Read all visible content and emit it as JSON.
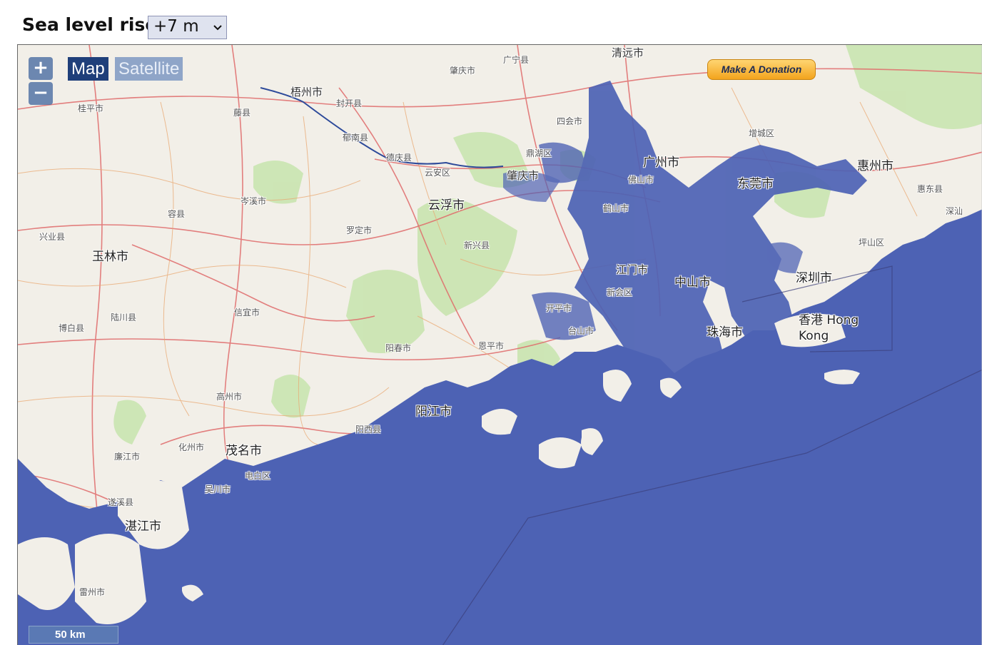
{
  "header": {
    "label": "Sea level rise:",
    "selected_value": "+7 m"
  },
  "controls": {
    "zoom_in": "+",
    "zoom_out": "−",
    "map_type_map": "Map",
    "map_type_satellite": "Satellite",
    "donate": "Make A Donation",
    "scale": "50 km"
  },
  "colors": {
    "flood": "#4d62b4",
    "land": "#f2efe8",
    "green": "#c9e4b0",
    "road_major": "#e06b6b",
    "road_minor": "#e9a871"
  },
  "cities": [
    {
      "name": "清远市"
    },
    {
      "name": "广宁县"
    },
    {
      "name": "肇庆市"
    },
    {
      "name": "梧州市"
    },
    {
      "name": "封开县"
    },
    {
      "name": "藤县"
    },
    {
      "name": "郁南县"
    },
    {
      "name": "德庆县"
    },
    {
      "name": "云安区"
    },
    {
      "name": "四会市"
    },
    {
      "name": "鼎湖区"
    },
    {
      "name": "肇庆市"
    },
    {
      "name": "广州市"
    },
    {
      "name": "佛山市"
    },
    {
      "name": "东莞市"
    },
    {
      "name": "增城区"
    },
    {
      "name": "惠州市"
    },
    {
      "name": "惠东县"
    },
    {
      "name": "深圳市"
    },
    {
      "name": "坪山区"
    },
    {
      "name": "香港 Hong Kong"
    },
    {
      "name": "中山市"
    },
    {
      "name": "珠海市"
    },
    {
      "name": "江门市"
    },
    {
      "name": "新会区"
    },
    {
      "name": "鹤山市"
    },
    {
      "name": "台山市"
    },
    {
      "name": "开平市"
    },
    {
      "name": "恩平市"
    },
    {
      "name": "阳春市"
    },
    {
      "name": "阳江市"
    },
    {
      "name": "阳西县"
    },
    {
      "name": "云浮市"
    },
    {
      "name": "新兴县"
    },
    {
      "name": "罗定市"
    },
    {
      "name": "信宜市"
    },
    {
      "name": "高州市"
    },
    {
      "name": "茂名市"
    },
    {
      "name": "化州市"
    },
    {
      "name": "电白区"
    },
    {
      "name": "廉江市"
    },
    {
      "name": "遂溪县"
    },
    {
      "name": "湛江市"
    },
    {
      "name": "雷州市"
    },
    {
      "name": "吴川市"
    },
    {
      "name": "玉林市"
    },
    {
      "name": "兴业县"
    },
    {
      "name": "容县"
    },
    {
      "name": "岑溪市"
    },
    {
      "name": "博白县"
    },
    {
      "name": "陆川县"
    },
    {
      "name": "桂平市"
    },
    {
      "name": "深汕"
    }
  ]
}
